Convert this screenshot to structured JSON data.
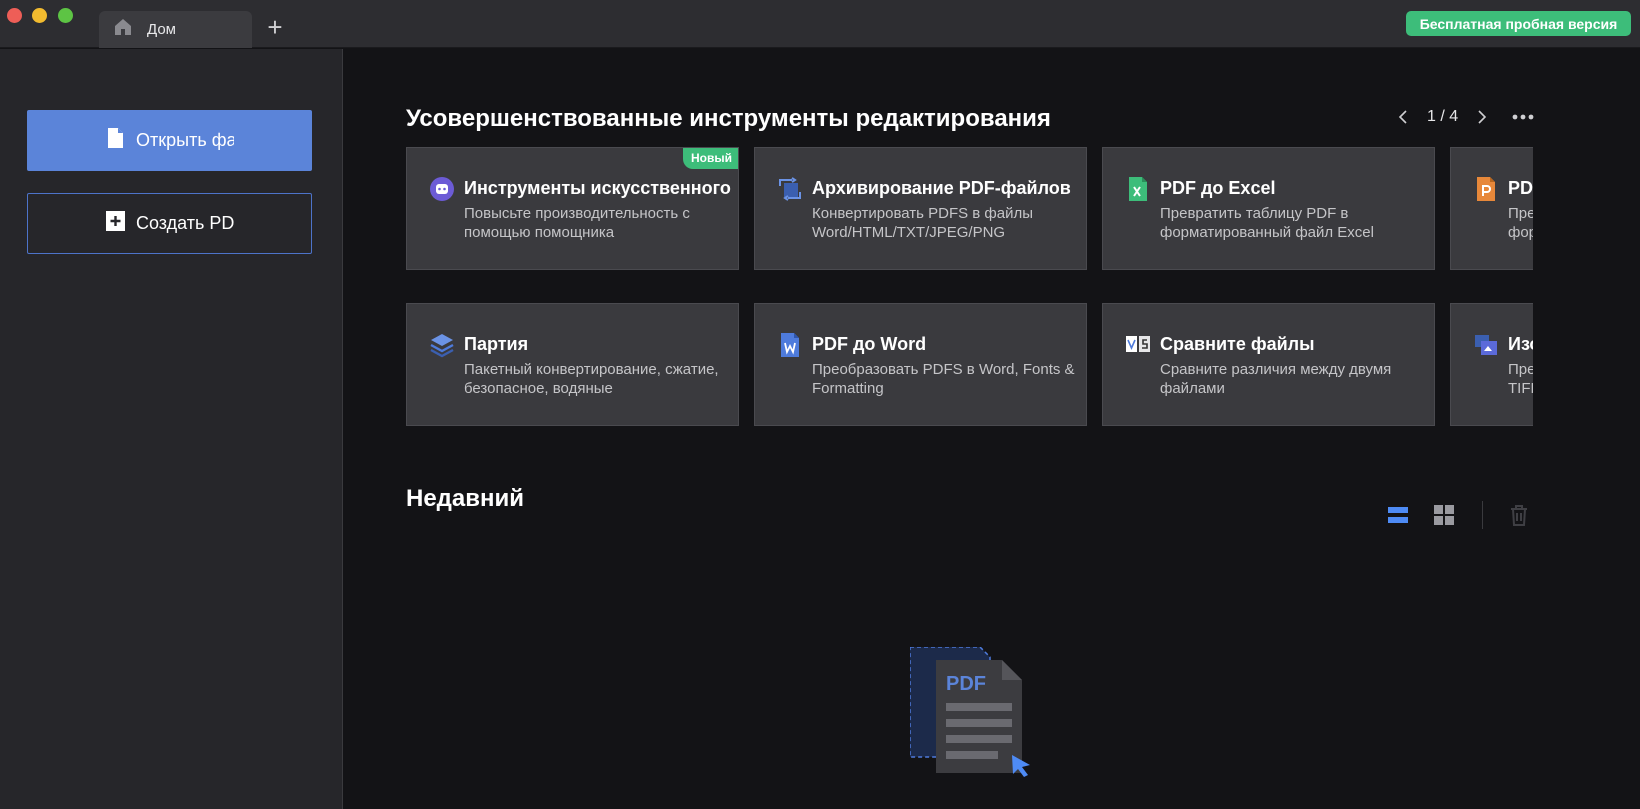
{
  "titlebar": {
    "tab_label": "Дом",
    "trial_button": "Бесплатная пробная версия"
  },
  "sidebar": {
    "open_button": "Открыть фа",
    "create_button": "Создать PD"
  },
  "tools": {
    "title": "Усовершенствованные инструменты редактирования",
    "page_indicator": "1 / 4",
    "cards": [
      {
        "title": "Инструменты искусственного",
        "desc": "Повысьте производительность с помощью помощника",
        "badge": "Новый",
        "icon": "ai-robot-icon",
        "color": "#6c5bd6"
      },
      {
        "title": "Архивирование PDF-файлов",
        "desc": "Конвертировать PDFS в файлы Word/HTML/TXT/JPEG/PNG",
        "icon": "convert-icon",
        "color": "#4e7bdc"
      },
      {
        "title": "PDF до Excel",
        "desc": "Превратить таблицу PDF в форматированный файл Excel",
        "icon": "excel-icon",
        "color": "#3dbd7a"
      },
      {
        "title": "PDF",
        "desc": "Пре фор",
        "icon": "powerpoint-icon",
        "color": "#e7883a"
      },
      {
        "title": "Партия",
        "desc": "Пакетный конвертирование, сжатие, безопасное, водяные",
        "icon": "batch-layers-icon",
        "color": "#4e7bdc"
      },
      {
        "title": "PDF до Word",
        "desc": "Преобразовать PDFS в Word, Fonts & Formatting",
        "icon": "word-icon",
        "color": "#4e7bdc"
      },
      {
        "title": "Сравните файлы",
        "desc": "Сравните различия между двумя файлами",
        "icon": "compare-icon",
        "color": "#ffffff"
      },
      {
        "title": "Изо",
        "desc": "Пре TIFF",
        "icon": "image-icon",
        "color": "#5b6ad9"
      }
    ]
  },
  "recent": {
    "title": "Недавний",
    "illustration_text": "PDF"
  },
  "colors": {
    "accent": "#5b84d9",
    "success": "#3dbd7a",
    "card_bg": "#3a3a3e",
    "page_bg": "#131316"
  }
}
